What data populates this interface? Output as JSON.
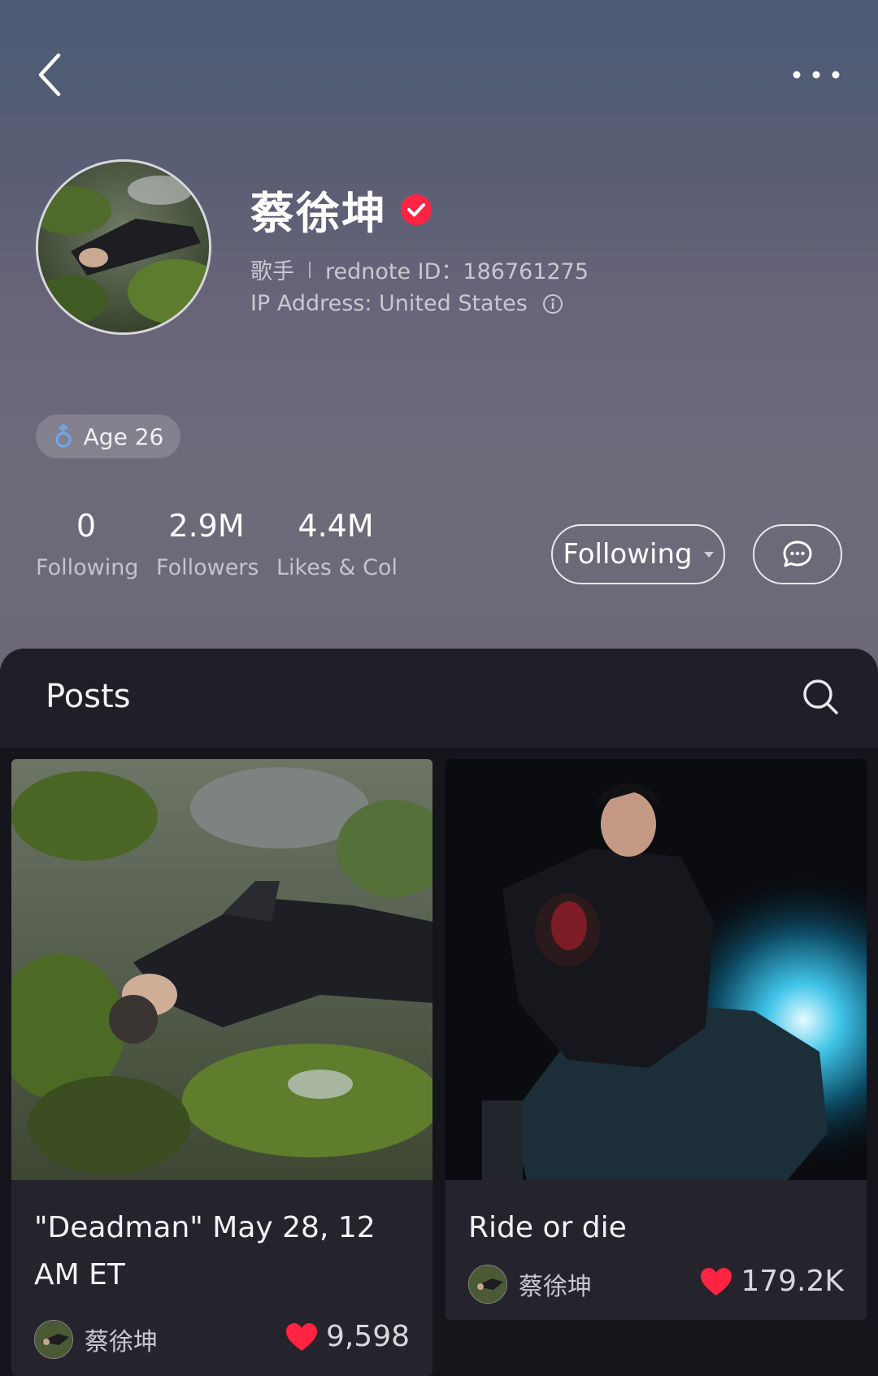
{
  "profile": {
    "name": "蔡徐坤",
    "occupation": "歌手",
    "rednote_id": "rednote ID：186761275",
    "ip_address": "IP Address: United States",
    "age_tag": "Age 26"
  },
  "stats": [
    {
      "value": "0",
      "label": "Following"
    },
    {
      "value": "2.9M",
      "label": "Followers"
    },
    {
      "value": "4.4M",
      "label": "Likes & Col"
    }
  ],
  "actions": {
    "follow_label": "Following"
  },
  "tabs": {
    "posts_label": "Posts"
  },
  "posts": [
    {
      "title": "\"Deadman\" May 28, 12 AM ET",
      "author": "蔡徐坤",
      "likes": "9,598"
    },
    {
      "title": "Ride or die",
      "author": "蔡徐坤",
      "likes": "179.2K"
    }
  ],
  "colors": {
    "verified": "#ff2442",
    "heart": "#ff2442",
    "male_icon": "#6fa8e8"
  },
  "icons": [
    "back-arrow-icon",
    "more-dots-icon",
    "verified-icon",
    "info-icon",
    "male-icon",
    "chat-bubble-icon",
    "search-icon",
    "heart-icon"
  ]
}
